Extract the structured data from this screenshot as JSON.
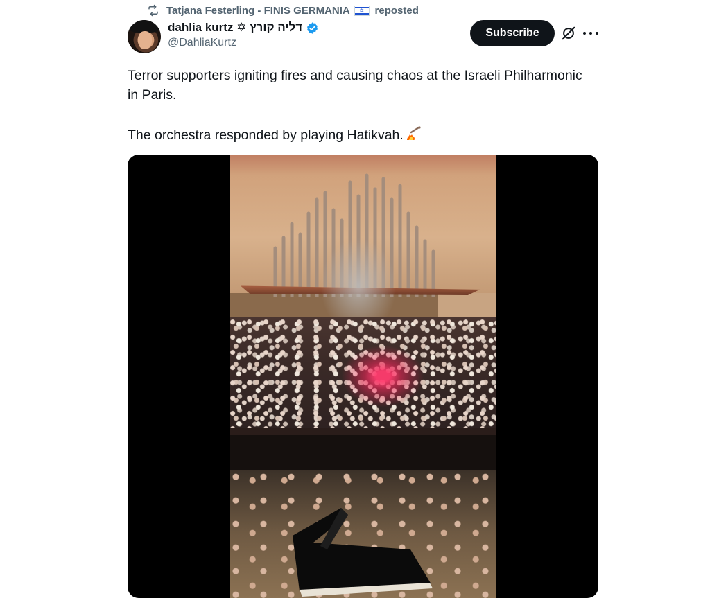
{
  "repost": {
    "name": "Tatjana Festerling - FINIS GERMANIA",
    "suffix": "reposted",
    "icon": "repost-icon",
    "flag_icon": "israel-flag-icon"
  },
  "author": {
    "display_name": "dahlia kurtz ✡ דליה קורץ",
    "handle": "@DahliaKurtz",
    "verified": true,
    "avatar_icon": "avatar"
  },
  "actions": {
    "subscribe_label": "Subscribe",
    "grok_icon": "grok-icon",
    "more_icon": "more-icon"
  },
  "tweet": {
    "line1": "Terror supporters igniting fires and causing chaos at the Israeli Philharmonic in Paris.",
    "line2": "The orchestra responded by playing Hatikvah.",
    "emoji": "musical-note-fire-emoji"
  },
  "media": {
    "type": "video",
    "description_icon": "video-thumbnail"
  },
  "colors": {
    "text_primary": "#0f1419",
    "text_secondary": "#536471",
    "verified_blue": "#1d9bf0",
    "button_bg": "#0f1419"
  }
}
